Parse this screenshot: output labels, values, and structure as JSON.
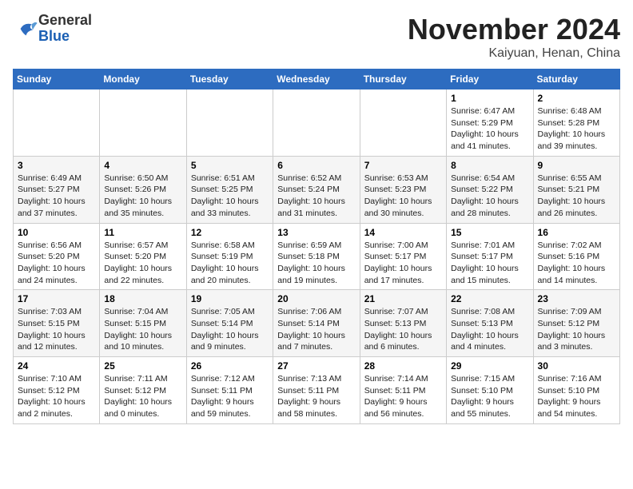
{
  "header": {
    "logo_general": "General",
    "logo_blue": "Blue",
    "month_title": "November 2024",
    "location": "Kaiyuan, Henan, China"
  },
  "weekdays": [
    "Sunday",
    "Monday",
    "Tuesday",
    "Wednesday",
    "Thursday",
    "Friday",
    "Saturday"
  ],
  "weeks": [
    [
      {
        "day": "",
        "info": ""
      },
      {
        "day": "",
        "info": ""
      },
      {
        "day": "",
        "info": ""
      },
      {
        "day": "",
        "info": ""
      },
      {
        "day": "",
        "info": ""
      },
      {
        "day": "1",
        "info": "Sunrise: 6:47 AM\nSunset: 5:29 PM\nDaylight: 10 hours\nand 41 minutes."
      },
      {
        "day": "2",
        "info": "Sunrise: 6:48 AM\nSunset: 5:28 PM\nDaylight: 10 hours\nand 39 minutes."
      }
    ],
    [
      {
        "day": "3",
        "info": "Sunrise: 6:49 AM\nSunset: 5:27 PM\nDaylight: 10 hours\nand 37 minutes."
      },
      {
        "day": "4",
        "info": "Sunrise: 6:50 AM\nSunset: 5:26 PM\nDaylight: 10 hours\nand 35 minutes."
      },
      {
        "day": "5",
        "info": "Sunrise: 6:51 AM\nSunset: 5:25 PM\nDaylight: 10 hours\nand 33 minutes."
      },
      {
        "day": "6",
        "info": "Sunrise: 6:52 AM\nSunset: 5:24 PM\nDaylight: 10 hours\nand 31 minutes."
      },
      {
        "day": "7",
        "info": "Sunrise: 6:53 AM\nSunset: 5:23 PM\nDaylight: 10 hours\nand 30 minutes."
      },
      {
        "day": "8",
        "info": "Sunrise: 6:54 AM\nSunset: 5:22 PM\nDaylight: 10 hours\nand 28 minutes."
      },
      {
        "day": "9",
        "info": "Sunrise: 6:55 AM\nSunset: 5:21 PM\nDaylight: 10 hours\nand 26 minutes."
      }
    ],
    [
      {
        "day": "10",
        "info": "Sunrise: 6:56 AM\nSunset: 5:20 PM\nDaylight: 10 hours\nand 24 minutes."
      },
      {
        "day": "11",
        "info": "Sunrise: 6:57 AM\nSunset: 5:20 PM\nDaylight: 10 hours\nand 22 minutes."
      },
      {
        "day": "12",
        "info": "Sunrise: 6:58 AM\nSunset: 5:19 PM\nDaylight: 10 hours\nand 20 minutes."
      },
      {
        "day": "13",
        "info": "Sunrise: 6:59 AM\nSunset: 5:18 PM\nDaylight: 10 hours\nand 19 minutes."
      },
      {
        "day": "14",
        "info": "Sunrise: 7:00 AM\nSunset: 5:17 PM\nDaylight: 10 hours\nand 17 minutes."
      },
      {
        "day": "15",
        "info": "Sunrise: 7:01 AM\nSunset: 5:17 PM\nDaylight: 10 hours\nand 15 minutes."
      },
      {
        "day": "16",
        "info": "Sunrise: 7:02 AM\nSunset: 5:16 PM\nDaylight: 10 hours\nand 14 minutes."
      }
    ],
    [
      {
        "day": "17",
        "info": "Sunrise: 7:03 AM\nSunset: 5:15 PM\nDaylight: 10 hours\nand 12 minutes."
      },
      {
        "day": "18",
        "info": "Sunrise: 7:04 AM\nSunset: 5:15 PM\nDaylight: 10 hours\nand 10 minutes."
      },
      {
        "day": "19",
        "info": "Sunrise: 7:05 AM\nSunset: 5:14 PM\nDaylight: 10 hours\nand 9 minutes."
      },
      {
        "day": "20",
        "info": "Sunrise: 7:06 AM\nSunset: 5:14 PM\nDaylight: 10 hours\nand 7 minutes."
      },
      {
        "day": "21",
        "info": "Sunrise: 7:07 AM\nSunset: 5:13 PM\nDaylight: 10 hours\nand 6 minutes."
      },
      {
        "day": "22",
        "info": "Sunrise: 7:08 AM\nSunset: 5:13 PM\nDaylight: 10 hours\nand 4 minutes."
      },
      {
        "day": "23",
        "info": "Sunrise: 7:09 AM\nSunset: 5:12 PM\nDaylight: 10 hours\nand 3 minutes."
      }
    ],
    [
      {
        "day": "24",
        "info": "Sunrise: 7:10 AM\nSunset: 5:12 PM\nDaylight: 10 hours\nand 2 minutes."
      },
      {
        "day": "25",
        "info": "Sunrise: 7:11 AM\nSunset: 5:12 PM\nDaylight: 10 hours\nand 0 minutes."
      },
      {
        "day": "26",
        "info": "Sunrise: 7:12 AM\nSunset: 5:11 PM\nDaylight: 9 hours\nand 59 minutes."
      },
      {
        "day": "27",
        "info": "Sunrise: 7:13 AM\nSunset: 5:11 PM\nDaylight: 9 hours\nand 58 minutes."
      },
      {
        "day": "28",
        "info": "Sunrise: 7:14 AM\nSunset: 5:11 PM\nDaylight: 9 hours\nand 56 minutes."
      },
      {
        "day": "29",
        "info": "Sunrise: 7:15 AM\nSunset: 5:10 PM\nDaylight: 9 hours\nand 55 minutes."
      },
      {
        "day": "30",
        "info": "Sunrise: 7:16 AM\nSunset: 5:10 PM\nDaylight: 9 hours\nand 54 minutes."
      }
    ]
  ]
}
